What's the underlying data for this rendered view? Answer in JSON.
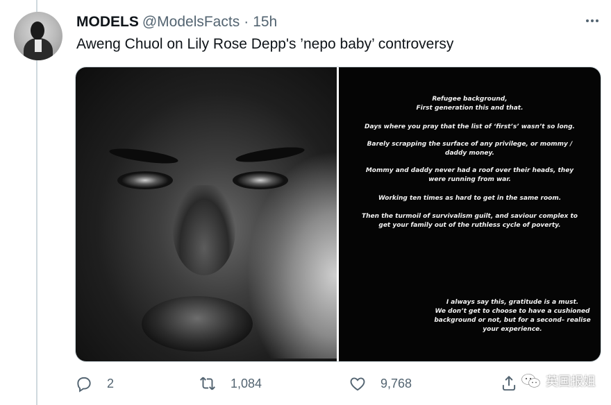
{
  "tweet": {
    "author_name": "MODELS",
    "author_handle": "@ModelsFacts",
    "separator": "·",
    "time": "15h",
    "text": "Aweng Chuol on Lily Rose Depp's ’nepo baby’ controversy"
  },
  "media": {
    "text_image_lines": [
      "Refugee background,",
      "First generation this and that.",
      "Days where you pray that the list of ‘first’s’ wasn’t so long.",
      "Barely scrapping the surface of any privilege, or mommy /",
      "daddy money.",
      "Mommy and daddy never had a roof over their heads, they",
      "were running from war.",
      "Working ten times as hard to get in the same room.",
      "Then the turmoil of survivalism guilt, and saviour complex to",
      "get your family out of the ruthless cycle of poverty.",
      "I always say this, gratitude is a must.",
      "We don’t get to choose to have a cushioned",
      "background or not, but for a second– realise",
      "your experience."
    ]
  },
  "actions": {
    "reply_count": "2",
    "retweet_count": "1,084",
    "like_count": "9,768"
  },
  "watermark": {
    "text": "英国报姐"
  },
  "icons": [
    "more-icon",
    "reply-icon",
    "retweet-icon",
    "like-icon",
    "share-icon",
    "wechat-logo-icon"
  ],
  "colors": {
    "text_primary": "#0f1419",
    "text_secondary": "#536471",
    "thread_line": "#cfd9de"
  }
}
